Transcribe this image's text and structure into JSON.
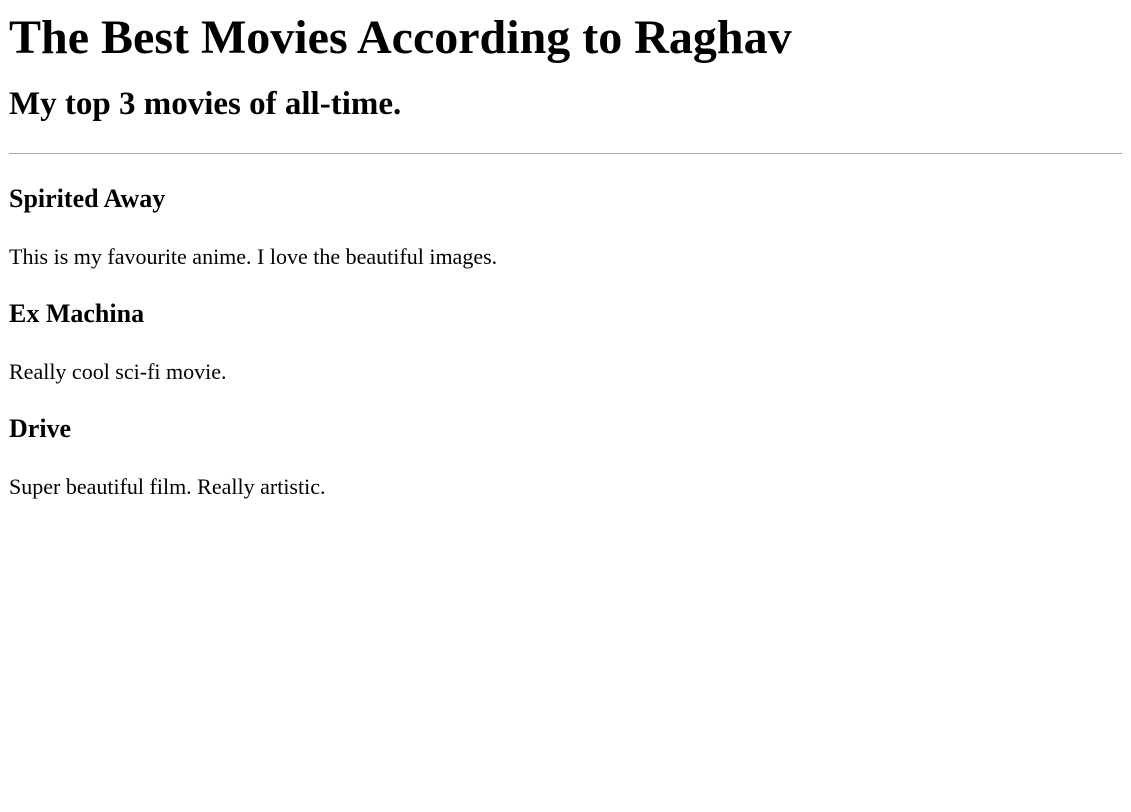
{
  "header": {
    "title": "The Best Movies According to Raghav",
    "subtitle": "My top 3 movies of all-time."
  },
  "movies": [
    {
      "title": "Spirited Away",
      "description": "This is my favourite anime. I love the beautiful images."
    },
    {
      "title": "Ex Machina",
      "description": "Really cool sci-fi movie."
    },
    {
      "title": "Drive",
      "description": "Super beautiful film. Really artistic."
    }
  ],
  "colors": {
    "text": "#000000",
    "background": "#ffffff",
    "divider": "#a8a8a8"
  }
}
